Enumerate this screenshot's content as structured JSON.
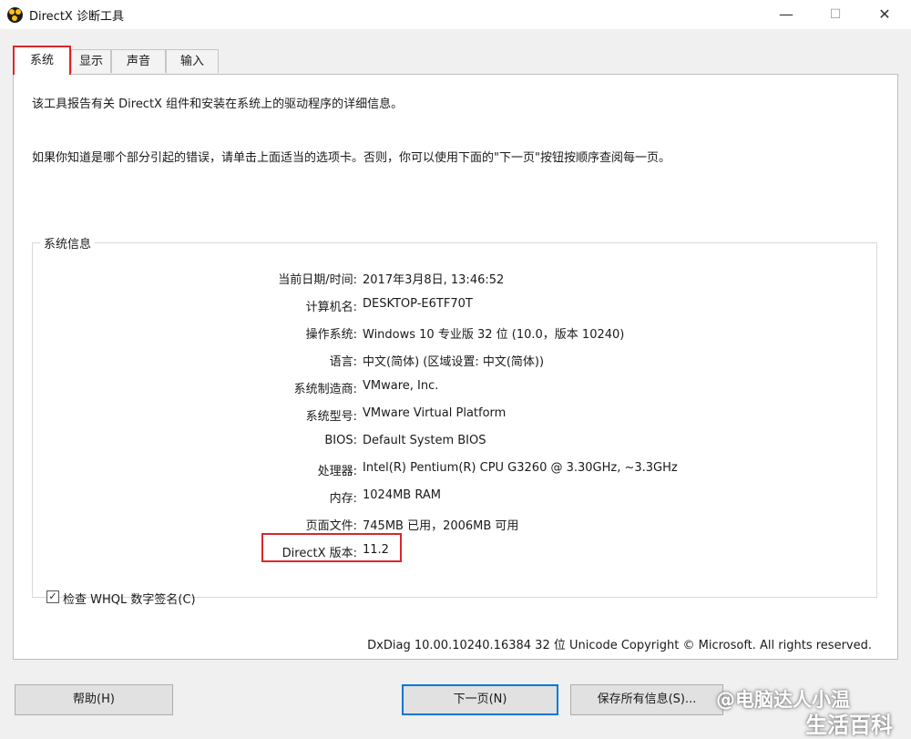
{
  "window": {
    "title": "DirectX 诊断工具",
    "icon": "directx-icon",
    "controls": {
      "minimize": "—",
      "maximize": "☐",
      "close": "✕"
    }
  },
  "tabs": [
    {
      "label": "系统",
      "active": true
    },
    {
      "label": "显示",
      "active": false
    },
    {
      "label": "声音",
      "active": false
    },
    {
      "label": "输入",
      "active": false
    }
  ],
  "intro": {
    "line1": "该工具报告有关 DirectX 组件和安装在系统上的驱动程序的详细信息。",
    "line2": "如果你知道是哪个部分引起的错误，请单击上面适当的选项卡。否则，你可以使用下面的\"下一页\"按钮按顺序查阅每一页。"
  },
  "system_info": {
    "group_title": "系统信息",
    "rows": [
      {
        "label": "当前日期/时间:",
        "value": "2017年3月8日, 13:46:52"
      },
      {
        "label": "计算机名:",
        "value": "DESKTOP-E6TF70T"
      },
      {
        "label": "操作系统:",
        "value": "Windows 10 专业版 32 位 (10.0，版本 10240)"
      },
      {
        "label": "语言:",
        "value": "中文(简体) (区域设置: 中文(简体))"
      },
      {
        "label": "系统制造商:",
        "value": "VMware, Inc."
      },
      {
        "label": "系统型号:",
        "value": "VMware Virtual Platform"
      },
      {
        "label": "BIOS:",
        "value": "Default System BIOS"
      },
      {
        "label": "处理器:",
        "value": "Intel(R) Pentium(R) CPU G3260 @ 3.30GHz, ~3.3GHz"
      },
      {
        "label": "内存:",
        "value": "1024MB RAM"
      },
      {
        "label": "页面文件:",
        "value": "745MB 已用，2006MB 可用"
      },
      {
        "label": "DirectX 版本:",
        "value": "11.2"
      }
    ]
  },
  "whql": {
    "label": "检查 WHQL 数字签名(C)",
    "checked": true,
    "mark": "✓"
  },
  "footer": "DxDiag 10.00.10240.16384 32 位 Unicode  Copyright © Microsoft. All rights reserved.",
  "buttons": {
    "help": "帮助(H)",
    "next": "下一页(N)",
    "save": "保存所有信息(S)..."
  },
  "watermark": {
    "line1": "@电脑达人小温",
    "line2": "生活百科"
  },
  "colors": {
    "highlight": "#d9262c",
    "focus": "#0078d7",
    "panel": "#ffffff",
    "chrome": "#f0f0f0"
  }
}
